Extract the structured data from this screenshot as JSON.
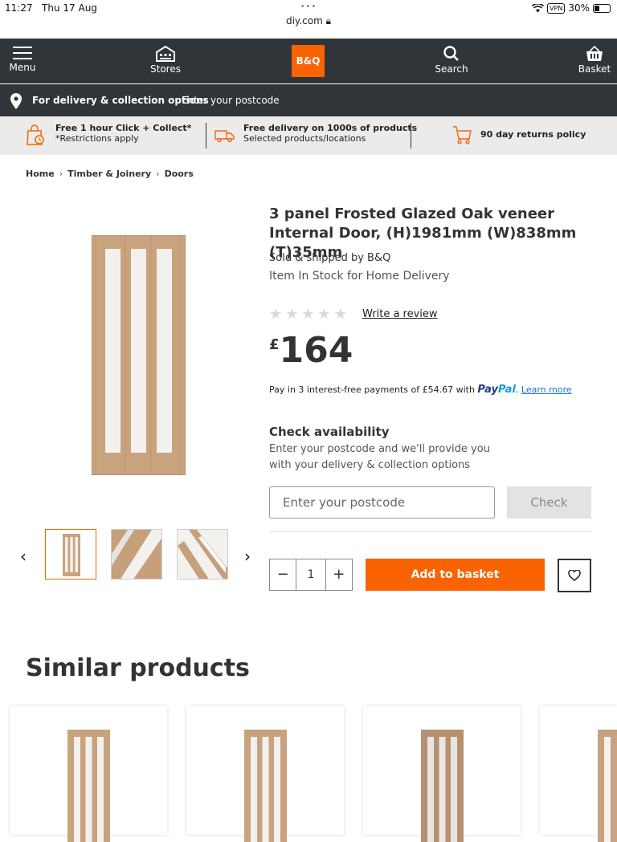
{
  "status_bar": {
    "time": "11:27",
    "date": "Thu 17 Aug",
    "url": "diy.com",
    "vpn": "VPN",
    "battery": "30%"
  },
  "nav": {
    "menu": "Menu",
    "stores": "Stores",
    "logo": "B&Q",
    "search": "Search",
    "basket": "Basket"
  },
  "delivery_bar": {
    "label": "For delivery & collection options",
    "postcode_prompt": "Enter your postcode"
  },
  "benefits": [
    {
      "title": "Free 1 hour Click + Collect*",
      "sub": "*Restrictions apply"
    },
    {
      "title": "Free delivery on 1000s of products",
      "sub": "Selected products/locations"
    },
    {
      "title": "90 day returns policy",
      "sub": ""
    }
  ],
  "breadcrumb": [
    "Home",
    "Timber & Joinery",
    "Doors"
  ],
  "product": {
    "title": "3 panel Frosted Glazed Oak veneer Internal Door, (H)1981mm (W)838mm (T)35mm",
    "sold_by": "Sold & shipped by B&Q",
    "stock": "Item In Stock for Home Delivery",
    "rating": 0,
    "write_review": "Write a review",
    "price_currency": "£",
    "price": "164",
    "paypal_text": "Pay in 3 interest-free payments of £54.67 with",
    "paypal_brand_a": "Pay",
    "paypal_brand_b": "Pal",
    "paypal_link": "Learn more"
  },
  "availability": {
    "title": "Check availability",
    "desc": "Enter your postcode and we'll provide you with your delivery & collection options",
    "placeholder": "Enter your postcode",
    "check": "Check"
  },
  "purchase": {
    "qty": "1",
    "minus": "−",
    "plus": "+",
    "add": "Add to basket"
  },
  "similar": {
    "title": "Similar products"
  },
  "colors": {
    "accent": "#f96302",
    "nav_bg": "#2f3539",
    "benefit_bg": "#ebebeb",
    "paypal_blue": "#253b80"
  }
}
